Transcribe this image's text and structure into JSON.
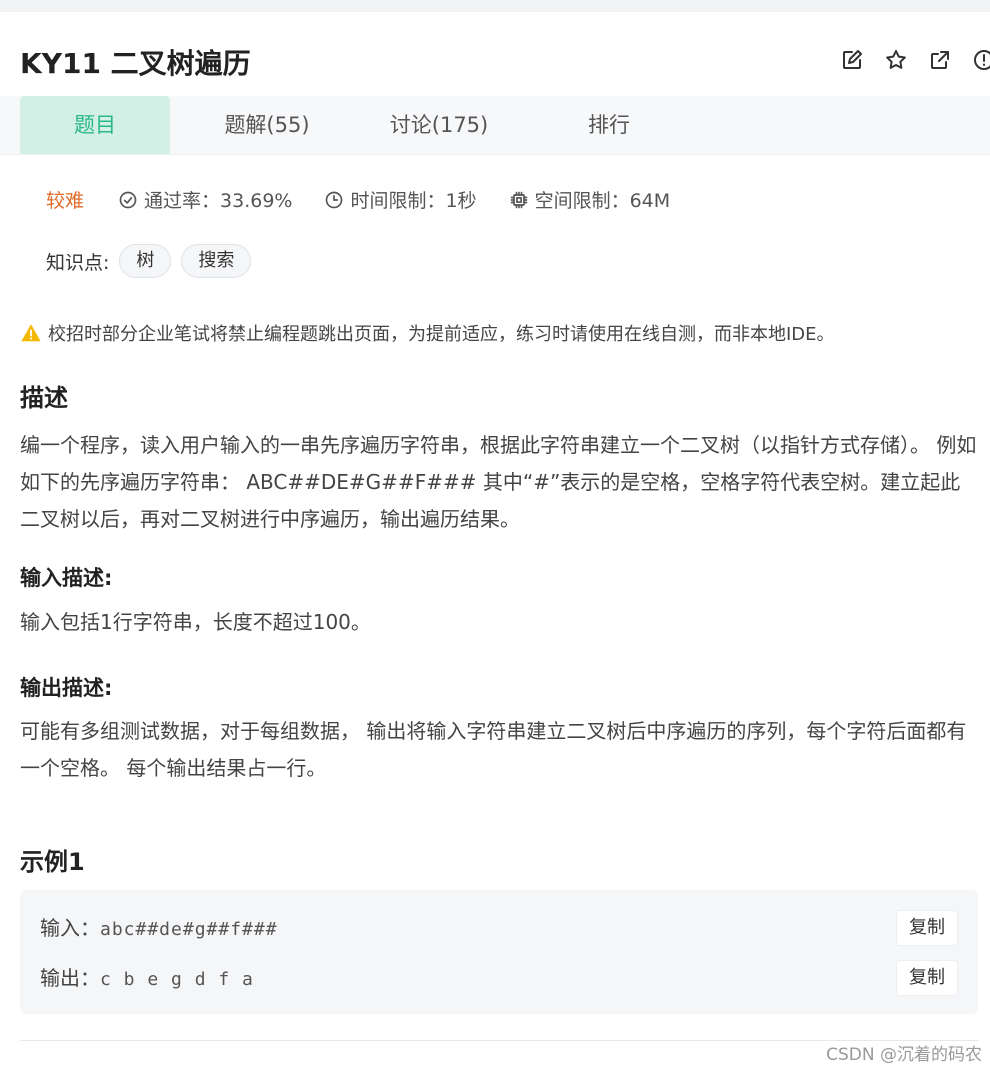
{
  "problem": {
    "title": "KY11  二叉树遍历"
  },
  "header_icons": [
    "edit-icon",
    "star-icon",
    "share-icon",
    "alert-icon"
  ],
  "tabs": [
    {
      "label": "题目",
      "active": true
    },
    {
      "label": "题解(55)",
      "active": false
    },
    {
      "label": "讨论(175)",
      "active": false
    },
    {
      "label": "排行",
      "active": false
    }
  ],
  "meta": {
    "difficulty": "较难",
    "pass_rate": "通过率：33.69%",
    "time_limit": "时间限制：1秒",
    "space_limit": "空间限制：64M"
  },
  "tags": {
    "label": "知识点:",
    "items": [
      "树",
      "搜索"
    ]
  },
  "warning": "校招时部分企业笔试将禁止编程题跳出页面，为提前适应，练习时请使用在线自测，而非本地IDE。",
  "description": {
    "heading": "描述",
    "text": "编一个程序，读入用户输入的一串先序遍历字符串，根据此字符串建立一个二叉树（以指针方式存储）。 例如如下的先序遍历字符串： ABC##DE#G##F### 其中“#”表示的是空格，空格字符代表空树。建立起此二叉树以后，再对二叉树进行中序遍历，输出遍历结果。"
  },
  "input_desc": {
    "heading": "输入描述:",
    "text": "输入包括1行字符串，长度不超过100。"
  },
  "output_desc": {
    "heading": "输出描述:",
    "text": "可能有多组测试数据，对于每组数据， 输出将输入字符串建立二叉树后中序遍历的序列，每个字符后面都有一个空格。 每个输出结果占一行。"
  },
  "example": {
    "heading": "示例1",
    "input_label": "输入：",
    "input_value": "abc##de#g##f###",
    "output_label": "输出：",
    "output_value": "c b e g d f a",
    "copy_label": "复制"
  },
  "watermark": "CSDN @沉着的码农",
  "colors": {
    "accent": "#2ab789",
    "tab_active_bg": "#d3f0e6",
    "difficulty": "#e0692a",
    "warning": "#f5b800"
  }
}
